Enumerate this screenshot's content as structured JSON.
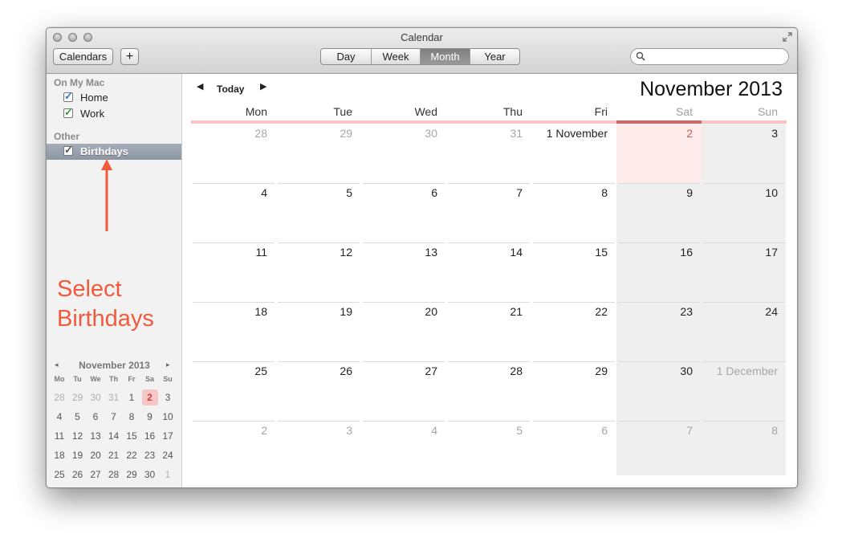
{
  "window": {
    "title": "Calendar"
  },
  "toolbar": {
    "calendars_label": "Calendars",
    "add_label": "+",
    "views": [
      {
        "label": "Day",
        "active": false
      },
      {
        "label": "Week",
        "active": false
      },
      {
        "label": "Month",
        "active": true
      },
      {
        "label": "Year",
        "active": false
      }
    ],
    "search_placeholder": ""
  },
  "sidebar": {
    "section_mac": "On My Mac",
    "home": {
      "label": "Home",
      "checked": true,
      "color": "#3a78c8"
    },
    "work": {
      "label": "Work",
      "checked": true,
      "color": "#3b9a3b"
    },
    "section_other": "Other",
    "birthdays": {
      "label": "Birthdays",
      "checked": true,
      "selected": true
    }
  },
  "annotation": {
    "line1": "Select",
    "line2": "Birthdays",
    "color": "#f15a3c"
  },
  "mini_calendar": {
    "title": "November 2013",
    "prev": "◂",
    "next": "▸",
    "weekdays": [
      "Mo",
      "Tu",
      "We",
      "Th",
      "Fr",
      "Sa",
      "Su"
    ],
    "weeks": [
      [
        "28",
        "29",
        "30",
        "31",
        "1",
        "2",
        "3"
      ],
      [
        "4",
        "5",
        "6",
        "7",
        "8",
        "9",
        "10"
      ],
      [
        "11",
        "12",
        "13",
        "14",
        "15",
        "16",
        "17"
      ],
      [
        "18",
        "19",
        "20",
        "21",
        "22",
        "23",
        "24"
      ],
      [
        "25",
        "26",
        "27",
        "28",
        "29",
        "30",
        "1"
      ]
    ],
    "today": "2"
  },
  "main": {
    "prev": "◀",
    "next": "▶",
    "today_label": "Today",
    "month": "November",
    "year": "2013",
    "weekdays": [
      "Mon",
      "Tue",
      "Wed",
      "Thu",
      "Fri",
      "Sat",
      "Sun"
    ],
    "weeks": [
      [
        "28",
        "29",
        "30",
        "31",
        "1 November",
        "2",
        "3"
      ],
      [
        "4",
        "5",
        "6",
        "7",
        "8",
        "9",
        "10"
      ],
      [
        "11",
        "12",
        "13",
        "14",
        "15",
        "16",
        "17"
      ],
      [
        "18",
        "19",
        "20",
        "21",
        "22",
        "23",
        "24"
      ],
      [
        "25",
        "26",
        "27",
        "28",
        "29",
        "30",
        "1 December"
      ],
      [
        "2",
        "3",
        "4",
        "5",
        "6",
        "7",
        "8"
      ]
    ],
    "today": "2"
  },
  "colors": {
    "accent": "#c76b6b",
    "today_text": "#e05454",
    "annotation": "#f15a3c"
  }
}
